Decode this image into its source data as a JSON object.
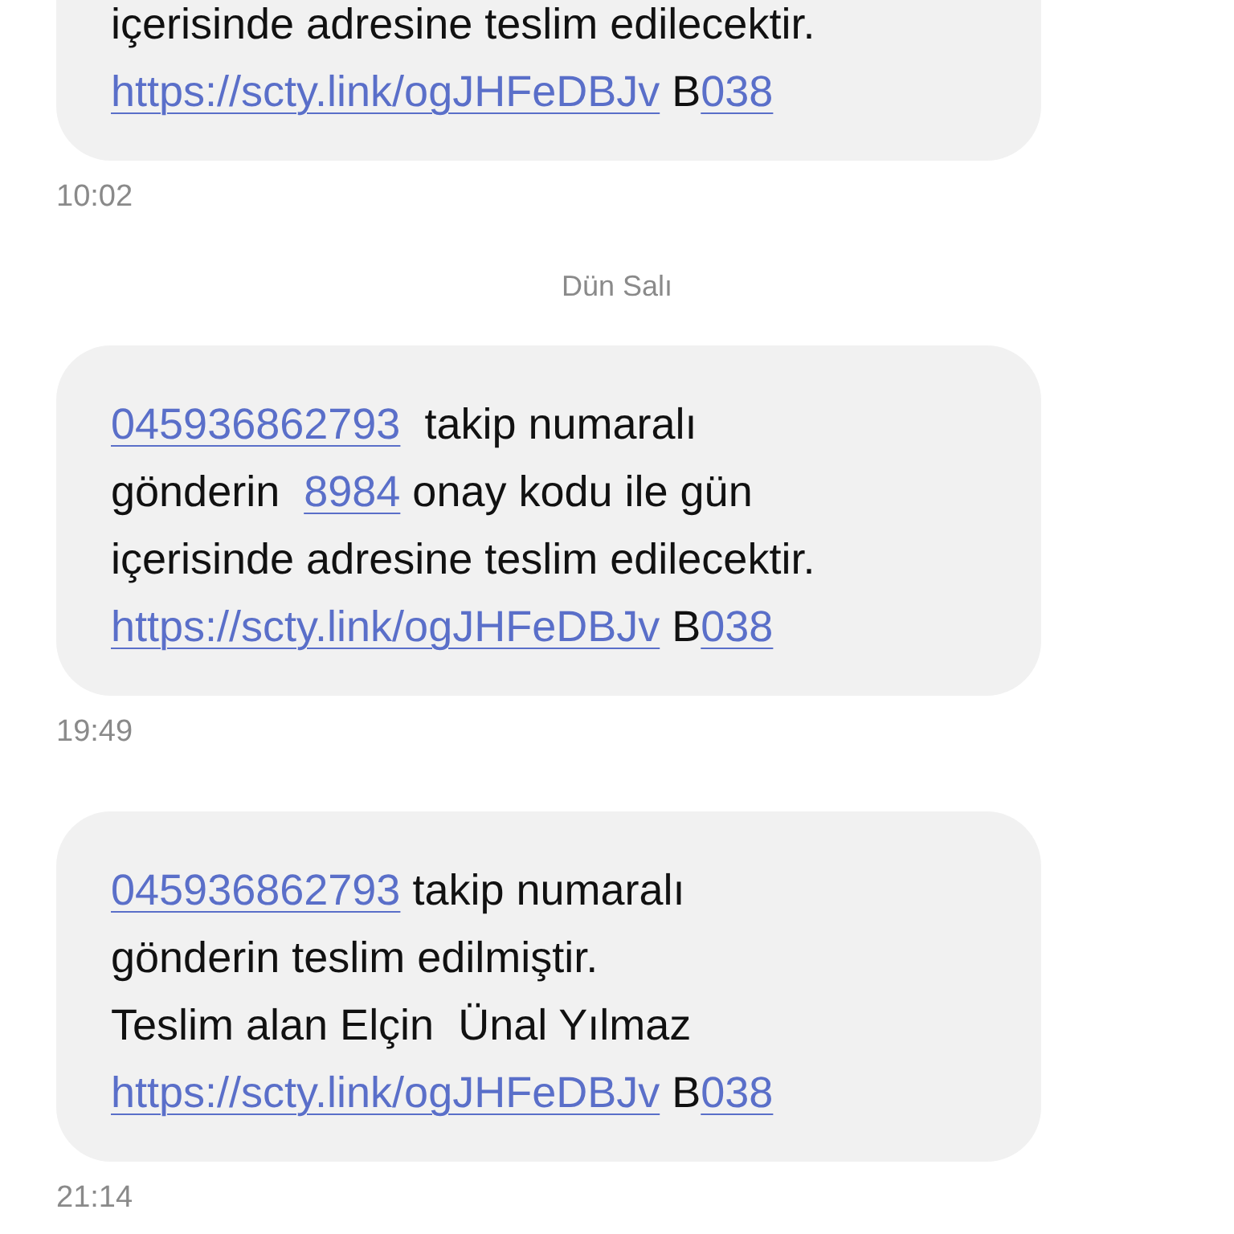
{
  "conversation": [
    {
      "kind": "message",
      "clipped_top": true,
      "time": "10:02",
      "lines": [
        [
          {
            "kind": "text",
            "text": "içerisinde adresine teslim edilecektir."
          }
        ],
        [
          {
            "kind": "link",
            "text": "https://scty.link/ogJHFeDBJv"
          },
          {
            "kind": "text",
            "text": " B"
          },
          {
            "kind": "link",
            "text": "038"
          }
        ]
      ]
    },
    {
      "kind": "date",
      "text": "Dün Salı"
    },
    {
      "kind": "message",
      "clipped_top": false,
      "time": "19:49",
      "lines": [
        [
          {
            "kind": "link",
            "text": "045936862793"
          },
          {
            "kind": "text",
            "text": "  takip numaralı"
          }
        ],
        [
          {
            "kind": "text",
            "text": "gönderin  "
          },
          {
            "kind": "link",
            "text": "8984"
          },
          {
            "kind": "text",
            "text": " onay kodu ile gün"
          }
        ],
        [
          {
            "kind": "text",
            "text": "içerisinde adresine teslim edilecektir."
          }
        ],
        [
          {
            "kind": "link",
            "text": "https://scty.link/ogJHFeDBJv"
          },
          {
            "kind": "text",
            "text": " B"
          },
          {
            "kind": "link",
            "text": "038"
          }
        ]
      ]
    },
    {
      "kind": "message",
      "clipped_top": false,
      "time": "21:14",
      "lines": [
        [
          {
            "kind": "link",
            "text": "045936862793"
          },
          {
            "kind": "text",
            "text": " takip numaralı"
          }
        ],
        [
          {
            "kind": "text",
            "text": "gönderin teslim edilmiştir."
          }
        ],
        [
          {
            "kind": "text",
            "text": "Teslim alan Elçin  Ünal Yılmaz"
          }
        ],
        [
          {
            "kind": "link",
            "text": "https://scty.link/ogJHFeDBJv"
          },
          {
            "kind": "text",
            "text": " B"
          },
          {
            "kind": "link",
            "text": "038"
          }
        ]
      ]
    }
  ]
}
